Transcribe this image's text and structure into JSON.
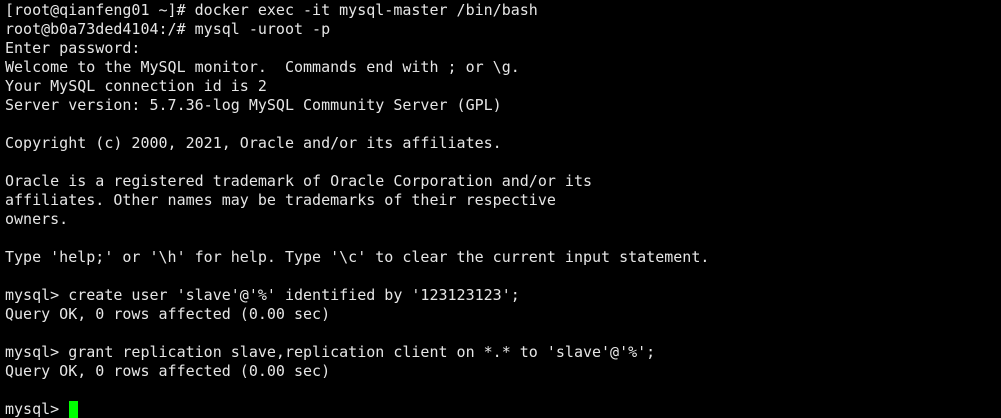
{
  "terminal": {
    "lines": [
      "[root@qianfeng01 ~]# docker exec -it mysql-master /bin/bash",
      "root@b0a73ded4104:/# mysql -uroot -p",
      "Enter password:",
      "Welcome to the MySQL monitor.  Commands end with ; or \\g.",
      "Your MySQL connection id is 2",
      "Server version: 5.7.36-log MySQL Community Server (GPL)",
      "",
      "Copyright (c) 2000, 2021, Oracle and/or its affiliates.",
      "",
      "Oracle is a registered trademark of Oracle Corporation and/or its",
      "affiliates. Other names may be trademarks of their respective",
      "owners.",
      "",
      "Type 'help;' or '\\h' for help. Type '\\c' to clear the current input statement.",
      "",
      "mysql> create user 'slave'@'%' identified by '123123123';",
      "Query OK, 0 rows affected (0.00 sec)",
      "",
      "mysql> grant replication slave,replication client on *.* to 'slave'@'%';",
      "Query OK, 0 rows affected (0.00 sec)",
      ""
    ],
    "prompt": "mysql> "
  },
  "colors": {
    "background": "#000000",
    "text": "#e6e6e6",
    "cursor": "#00ff00"
  }
}
